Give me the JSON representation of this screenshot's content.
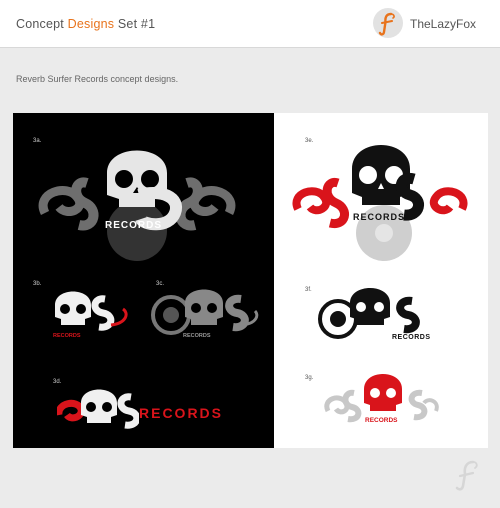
{
  "header": {
    "title_prefix": "Concept ",
    "title_accent": "Designs",
    "title_suffix": " Set #1",
    "brand_name": "TheLazyFox"
  },
  "description": "Reverb Surfer Records concept designs.",
  "colors": {
    "accent": "#e8731c",
    "logo_red": "#d9141b"
  },
  "designs": [
    {
      "label": "3a.",
      "wordmark": "RECORDS"
    },
    {
      "label": "3b.",
      "wordmark": "RECORDS"
    },
    {
      "label": "3c.",
      "wordmark": "RECORDS"
    },
    {
      "label": "3d.",
      "wordmark": "RECORDS"
    },
    {
      "label": "3e.",
      "wordmark": "RECORDS"
    },
    {
      "label": "3f.",
      "wordmark": "RECORDS"
    },
    {
      "label": "3g.",
      "wordmark": "RECORDS"
    }
  ]
}
